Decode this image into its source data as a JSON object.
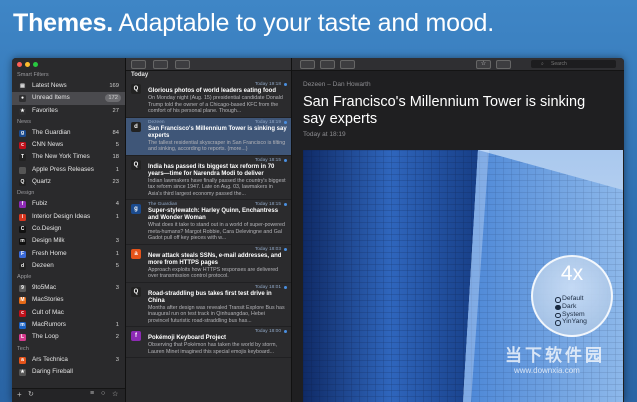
{
  "headline": {
    "bold": "Themes.",
    "rest": "Adaptable to your taste and mood."
  },
  "sidebar": {
    "sections": {
      "smart": "Smart Filters",
      "news": "News",
      "design": "Design",
      "apple": "Apple",
      "tech": "Tech"
    },
    "smart_items": [
      {
        "label": "Latest News",
        "count": "169",
        "color": "#2f2f31",
        "glyph": "▤"
      },
      {
        "label": "Unread Items",
        "count": "172",
        "color": "#2f2f31",
        "glyph": "●"
      },
      {
        "label": "Favorites",
        "count": "27",
        "color": "#2f2f31",
        "glyph": "★"
      }
    ],
    "news_items": [
      {
        "label": "The Guardian",
        "count": "84",
        "color": "#1b4b8e",
        "glyph": "g"
      },
      {
        "label": "CNN News",
        "count": "5",
        "color": "#c0111b",
        "glyph": "c"
      },
      {
        "label": "The New York Times",
        "count": "18",
        "color": "#222222",
        "glyph": "T"
      },
      {
        "label": "Apple Press Releases",
        "count": "1",
        "color": "#555555",
        "glyph": ""
      },
      {
        "label": "Quartz",
        "count": "23",
        "color": "#222222",
        "glyph": "Q"
      }
    ],
    "design_items": [
      {
        "label": "Fubiz",
        "count": "4",
        "color": "#8d2ab4",
        "glyph": "f"
      },
      {
        "label": "Interior Design Ideas",
        "count": "1",
        "color": "#d6361f",
        "glyph": "i"
      },
      {
        "label": "Co.Design",
        "count": "",
        "color": "#111111",
        "glyph": "C"
      },
      {
        "label": "Design Milk",
        "count": "3",
        "color": "#111111",
        "glyph": "m"
      },
      {
        "label": "Fresh Home",
        "count": "1",
        "color": "#3a6ad8",
        "glyph": "F"
      },
      {
        "label": "Dezeen",
        "count": "5",
        "color": "#222222",
        "glyph": "d"
      }
    ],
    "apple_items": [
      {
        "label": "9to5Mac",
        "count": "3",
        "color": "#5a5a5a",
        "glyph": "9"
      },
      {
        "label": "MacStories",
        "count": "",
        "color": "#e56a17",
        "glyph": "M"
      },
      {
        "label": "Cult of Mac",
        "count": "",
        "color": "#c0111b",
        "glyph": "c"
      },
      {
        "label": "MacRumors",
        "count": "1",
        "color": "#1b62c4",
        "glyph": "m"
      },
      {
        "label": "The Loop",
        "count": "2",
        "color": "#d43a8c",
        "glyph": "L"
      }
    ],
    "tech_items": [
      {
        "label": "Ars Technica",
        "count": "3",
        "color": "#e5531a",
        "glyph": "a"
      },
      {
        "label": "Daring Fireball",
        "count": "",
        "color": "#555555",
        "glyph": "★"
      }
    ]
  },
  "list": {
    "day_label": "Today",
    "articles": [
      {
        "source": "",
        "time": "Today 19:18",
        "title": "Glorious photos of world leaders eating food",
        "excerpt": "On Monday night (Aug. 15) presidential candidate Donald Trump told the owner of a Chicago-based KFC from the comfort of his personal plane. Though...",
        "color": "#222222",
        "glyph": "Q",
        "selected": false
      },
      {
        "source": "Dezeen",
        "time": "Today 18:19",
        "title": "San Francisco's Millennium Tower is sinking say experts",
        "excerpt": "The tallest residential skyscraper in San Francisco is tilting and sinking, according to reports. (more...)",
        "color": "#222222",
        "glyph": "d",
        "selected": true
      },
      {
        "source": "",
        "time": "Today 18:15",
        "title": "India has passed its biggest tax reform in 70 years—time for Narendra Modi to deliver",
        "excerpt": "Indian lawmakers have finally passed the country's biggest tax reform since 1947. Late on Aug. 03, lawmakers in Asia's third largest economy passed the...",
        "color": "#222222",
        "glyph": "Q",
        "selected": false
      },
      {
        "source": "The Guardian",
        "time": "Today 18:15",
        "title": "Super-stylewatch: Harley Quinn, Enchantress and Wonder Woman",
        "excerpt": "What does it take to stand out in a world of super-powered meta-humans? Margot Robbie, Cara Delevingne and Gal Gadot pull off key pieces with w...",
        "color": "#1b4b8e",
        "glyph": "g",
        "selected": false
      },
      {
        "source": "",
        "time": "Today 18:03",
        "title": "New attack steals SSNs, e-mail addresses, and more from HTTPS pages",
        "excerpt": "Approach exploits how HTTPS responses are delivered over transmission control protocol.",
        "color": "#e5531a",
        "glyph": "a",
        "selected": false
      },
      {
        "source": "",
        "time": "Today 18:01",
        "title": "Road-straddling bus takes first test drive in China",
        "excerpt": "Months after design was revealed Transit Explore Bus has inaugural run on test track in Qinhuangdao, Hebei provincel futuristic road-straddling bus has...",
        "color": "#222222",
        "glyph": "Q",
        "selected": false
      },
      {
        "source": "",
        "time": "Today 18:00",
        "title": "Pokémoji Keyboard Project",
        "excerpt": "Observing that Pokémon has taken the world by storm, Lauren Minet imagined this special emojis keyboard...",
        "color": "#8d2ab4",
        "glyph": "f",
        "selected": false
      }
    ]
  },
  "reader": {
    "search_placeholder": "Search",
    "source": "Dezeen – Dan Howarth",
    "title": "San Francisco's Millennium Tower is sinking say experts",
    "time": "Today at 18:19"
  },
  "badge": {
    "big": "4x",
    "options": [
      {
        "label": "Default",
        "selected": false
      },
      {
        "label": "Dark",
        "selected": true
      },
      {
        "label": "System",
        "selected": false
      },
      {
        "label": "YinYang",
        "selected": false
      }
    ]
  },
  "watermark": {
    "text": "当下软件园",
    "url": "www.downxia.com"
  }
}
